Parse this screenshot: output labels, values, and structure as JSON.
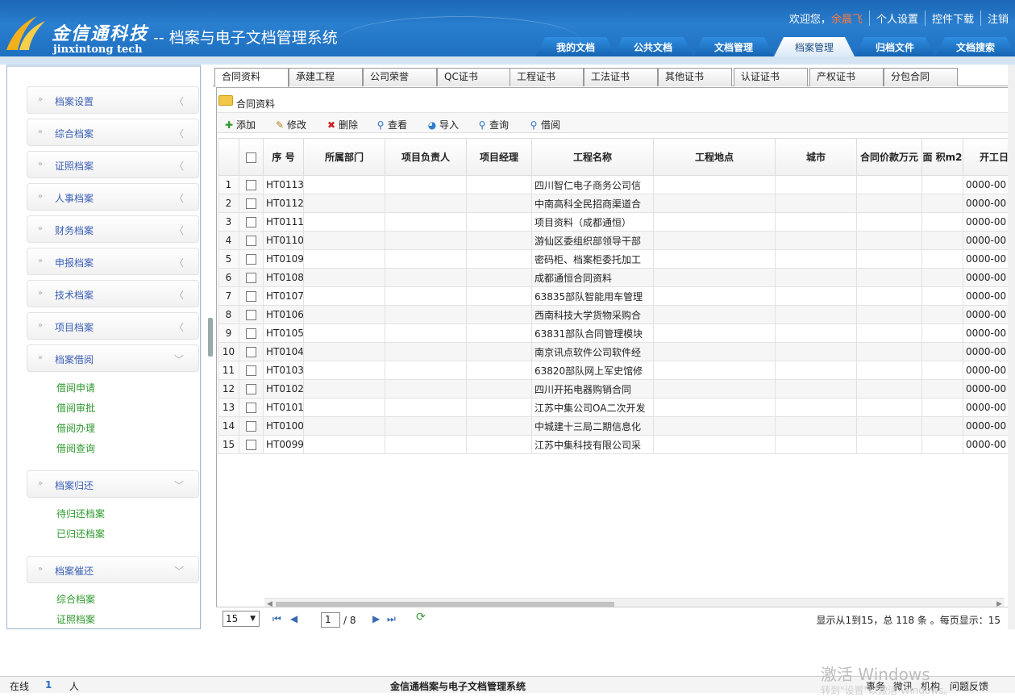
{
  "header": {
    "logo_cn": "金信通科技",
    "logo_en": "jinxintong tech",
    "system_title": "-- 档案与电子文档管理系统",
    "welcome": "欢迎您，",
    "username": "余晨飞",
    "links": [
      "个人设置",
      "控件下载",
      "注销"
    ],
    "nav_tabs": [
      "我的文档",
      "公共文档",
      "文档管理",
      "档案管理",
      "归档文件",
      "文档搜索"
    ],
    "active_nav": "档案管理"
  },
  "sidebar": {
    "menus": [
      {
        "label": "档案设置",
        "expanded": false
      },
      {
        "label": "综合档案",
        "expanded": false
      },
      {
        "label": "证照档案",
        "expanded": false
      },
      {
        "label": "人事档案",
        "expanded": false
      },
      {
        "label": "财务档案",
        "expanded": false
      },
      {
        "label": "申报档案",
        "expanded": false
      },
      {
        "label": "技术档案",
        "expanded": false
      },
      {
        "label": "项目档案",
        "expanded": false
      },
      {
        "label": "档案借阅",
        "expanded": true,
        "items": [
          "借阅申请",
          "借阅审批",
          "借阅办理",
          "借阅查询"
        ]
      },
      {
        "label": "档案归还",
        "expanded": true,
        "items": [
          "待归还档案",
          "已归还档案"
        ]
      },
      {
        "label": "档案催还",
        "expanded": true,
        "items": [
          "综合档案",
          "证照档案"
        ]
      }
    ]
  },
  "content_tabs": [
    "合同资料",
    "承建工程",
    "公司荣誉",
    "QC证书",
    "工程证书",
    "工法证书",
    "其他证书",
    "认证证书",
    "产权证书",
    "分包合同"
  ],
  "active_tab": "合同资料",
  "panel_title": "合同资料",
  "toolbar": [
    "添加",
    "修改",
    "删除",
    "查看",
    "导入",
    "查询",
    "借阅"
  ],
  "grid": {
    "columns": [
      "序 号",
      "所属部门",
      "项目负责人",
      "项目经理",
      "工程名称",
      "工程地点",
      "城市",
      "合同价款万元",
      "面 积m2",
      "开工日"
    ],
    "rows": [
      {
        "num": "1",
        "code": "HT0113",
        "name": "四川智仁电子商务公司信",
        "date": "0000-00"
      },
      {
        "num": "2",
        "code": "HT0112",
        "name": "中南高科全民招商渠道合",
        "date": "0000-00"
      },
      {
        "num": "3",
        "code": "HT0111",
        "name": "项目资料（成都通恒）",
        "date": "0000-00"
      },
      {
        "num": "4",
        "code": "HT0110",
        "name": "游仙区委组织部领导干部",
        "date": "0000-00"
      },
      {
        "num": "5",
        "code": "HT0109",
        "name": "密码柜、档案柜委托加工",
        "date": "0000-00"
      },
      {
        "num": "6",
        "code": "HT0108",
        "name": "成都通恒合同资料",
        "date": "0000-00"
      },
      {
        "num": "7",
        "code": "HT0107",
        "name": "63835部队智能用车管理",
        "date": "0000-00"
      },
      {
        "num": "8",
        "code": "HT0106",
        "name": "西南科技大学货物采购合",
        "date": "0000-00"
      },
      {
        "num": "9",
        "code": "HT0105",
        "name": "63831部队合同管理模块",
        "date": "0000-00"
      },
      {
        "num": "10",
        "code": "HT0104",
        "name": "南京讯点软件公司软件经",
        "date": "0000-00"
      },
      {
        "num": "11",
        "code": "HT0103",
        "name": "63820部队网上军史馆修",
        "date": "0000-00"
      },
      {
        "num": "12",
        "code": "HT0102",
        "name": "四川开拓电器购销合同",
        "date": "0000-00"
      },
      {
        "num": "13",
        "code": "HT0101",
        "name": "江苏中集公司OA二次开发",
        "date": "0000-00"
      },
      {
        "num": "14",
        "code": "HT0100",
        "name": "中城建十三局二期信息化",
        "date": "0000-00"
      },
      {
        "num": "15",
        "code": "HT0099",
        "name": "江苏中集科技有限公司采",
        "date": "0000-00"
      }
    ]
  },
  "pager": {
    "page_size": "15",
    "current_page": "1",
    "total_pages": "/ 8",
    "summary": "显示从1到15，总 118 条 。每页显示：15"
  },
  "footer": {
    "online_label": "在线",
    "online_count": "1",
    "online_unit": "人",
    "center": "金信通档案与电子文档管理系统",
    "links": [
      "事务",
      "微讯",
      "机构",
      "问题反馈"
    ],
    "watermark": "激活 Windows",
    "watermark_sub": "转到\"设置\"以激活 Windows。"
  },
  "colors": {
    "header_blue": "#1e6fc0",
    "menu_text": "#3a5fb5",
    "submenu_text": "#2f9a2f",
    "username": "#ff7a3a"
  }
}
